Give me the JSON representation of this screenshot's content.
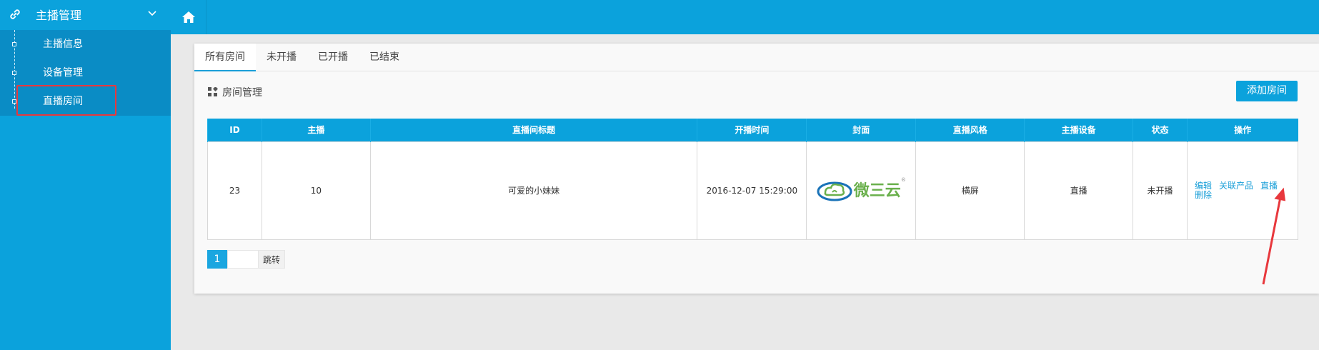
{
  "sidebar": {
    "menu_title": "主播管理",
    "items": [
      {
        "label": "主播信息"
      },
      {
        "label": "设备管理"
      },
      {
        "label": "直播房间"
      }
    ]
  },
  "tabs": [
    {
      "label": "所有房间"
    },
    {
      "label": "未开播"
    },
    {
      "label": "已开播"
    },
    {
      "label": "已结束"
    }
  ],
  "section": {
    "title": "房间管理",
    "add_button": "添加房间"
  },
  "table": {
    "headers": [
      "ID",
      "主播",
      "直播间标题",
      "开播时间",
      "封面",
      "直播风格",
      "主播设备",
      "状态",
      "操作"
    ],
    "rows": [
      {
        "id": "23",
        "anchor": "10",
        "title": "可爱的小妹妹",
        "start_time": "2016-12-07 15:29:00",
        "cover_text": "微三云",
        "style": "横屏",
        "device": "直播",
        "status": "未开播",
        "actions": {
          "edit": "编辑",
          "delete": "删除",
          "related": "关联产品",
          "live": "直播"
        }
      }
    ]
  },
  "pager": {
    "current_page": "1",
    "go_label": "跳转"
  },
  "colors": {
    "primary": "#0ba2dc",
    "sidebar_sub": "#0a8cc5",
    "highlight": "#e8383d",
    "logo_green": "#6ab04c",
    "logo_blue": "#1a73b8"
  }
}
